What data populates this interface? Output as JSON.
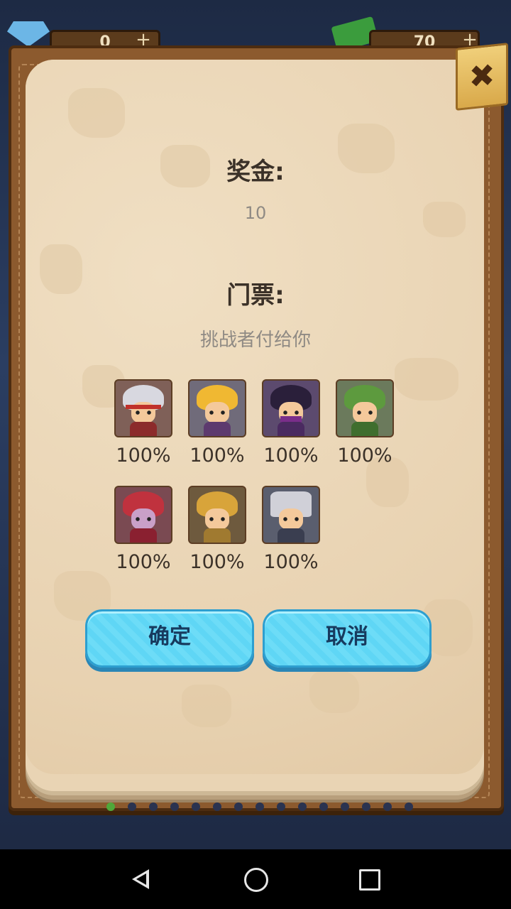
{
  "hud": {
    "left_value": "0",
    "right_value": "70",
    "left_plus": "+",
    "right_plus": "+"
  },
  "dialog": {
    "close_symbol": "✖",
    "bonus_label": "奖金:",
    "bonus_value": "10",
    "ticket_label": "门票:",
    "ticket_desc": "挑战者付给你",
    "heroes": [
      {
        "pct": "100%"
      },
      {
        "pct": "100%"
      },
      {
        "pct": "100%"
      },
      {
        "pct": "100%"
      },
      {
        "pct": "100%"
      },
      {
        "pct": "100%"
      },
      {
        "pct": "100%"
      }
    ],
    "confirm_label": "确定",
    "cancel_label": "取消"
  },
  "page_indicator": {
    "count": 15,
    "active_index": 0
  },
  "colors": {
    "page_bg": "#e9d4b4",
    "button_blue": "#5fd6f5",
    "book_brown": "#8c5a2e"
  },
  "icons": [
    "gem-icon",
    "cash-icon",
    "close-icon",
    "back-icon",
    "home-icon",
    "recents-icon"
  ]
}
